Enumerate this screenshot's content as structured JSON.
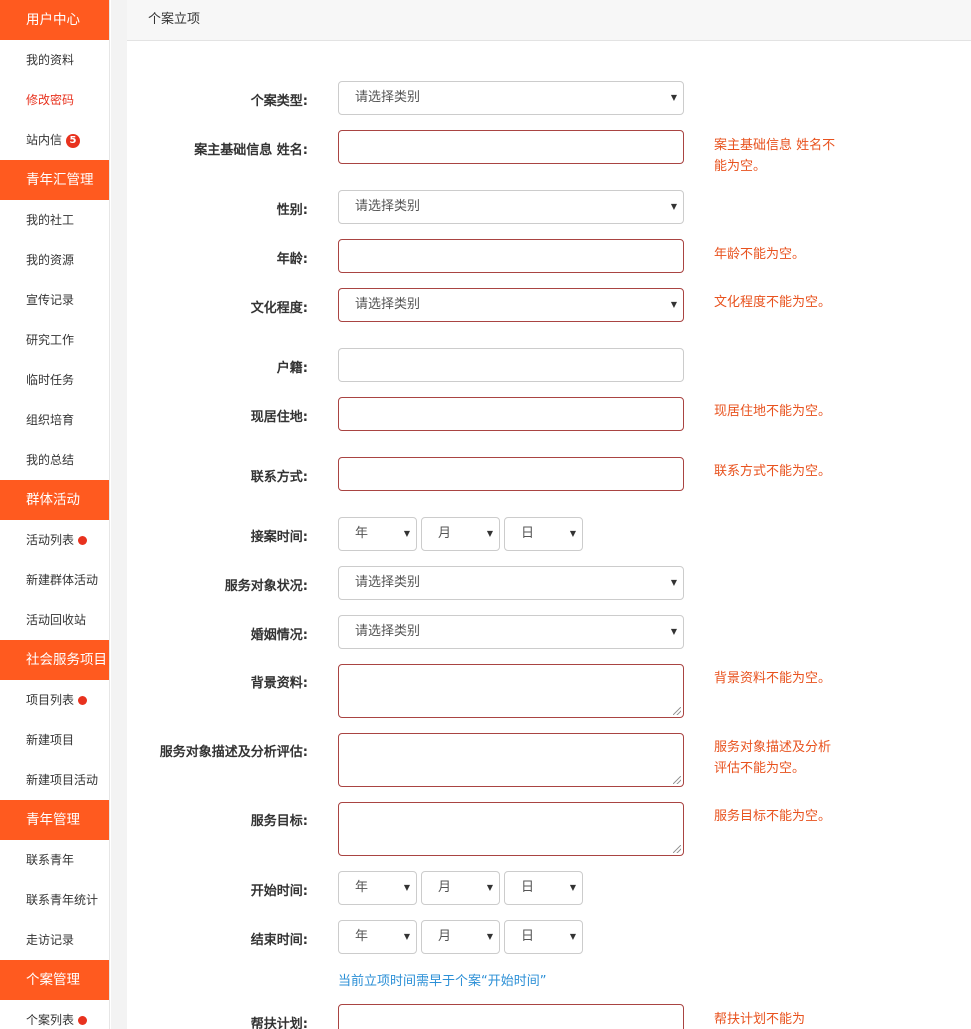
{
  "sidebar": {
    "sections": [
      {
        "title": "用户中心",
        "items": [
          {
            "label": "我的资料"
          },
          {
            "label": "修改密码",
            "active": true
          },
          {
            "label": "站内信",
            "badge": "5"
          }
        ]
      },
      {
        "title": "青年汇管理",
        "items": [
          {
            "label": "我的社工"
          },
          {
            "label": "我的资源"
          },
          {
            "label": "宣传记录"
          },
          {
            "label": "研究工作"
          },
          {
            "label": "临时任务"
          },
          {
            "label": "组织培育"
          },
          {
            "label": "我的总结"
          }
        ]
      },
      {
        "title": "群体活动",
        "items": [
          {
            "label": "活动列表",
            "dot": true
          },
          {
            "label": "新建群体活动"
          },
          {
            "label": "活动回收站"
          }
        ]
      },
      {
        "title": "社会服务项目",
        "items": [
          {
            "label": "项目列表",
            "dot": true
          },
          {
            "label": "新建项目"
          },
          {
            "label": "新建项目活动"
          }
        ]
      },
      {
        "title": "青年管理",
        "items": [
          {
            "label": "联系青年"
          },
          {
            "label": "联系青年统计"
          },
          {
            "label": "走访记录"
          }
        ]
      },
      {
        "title": "个案管理",
        "items": [
          {
            "label": "个案列表",
            "dot": true
          }
        ]
      }
    ]
  },
  "main": {
    "header_title": "个案立项",
    "form": {
      "case_type": {
        "label": "个案类型:",
        "value": "请选择类别"
      },
      "name": {
        "label": "案主基础信息 姓名:",
        "value": "",
        "error": "案主基础信息 姓名不能为空。"
      },
      "gender": {
        "label": "性别:",
        "value": "请选择类别"
      },
      "age": {
        "label": "年龄:",
        "value": "",
        "error": "年龄不能为空。"
      },
      "education": {
        "label": "文化程度:",
        "value": "请选择类别",
        "error": "文化程度不能为空。"
      },
      "hukou": {
        "label": "户籍:",
        "value": ""
      },
      "residence": {
        "label": "现居住地:",
        "value": "",
        "error": "现居住地不能为空。"
      },
      "contact": {
        "label": "联系方式:",
        "value": "",
        "error": "联系方式不能为空。"
      },
      "intake_date": {
        "label": "接案时间:",
        "year": "年",
        "month": "月",
        "day": "日"
      },
      "client_status": {
        "label": "服务对象状况:",
        "value": "请选择类别"
      },
      "marital": {
        "label": "婚姻情况:",
        "value": "请选择类别"
      },
      "background": {
        "label": "背景资料:",
        "value": "",
        "error": "背景资料不能为空。"
      },
      "assessment": {
        "label": "服务对象描述及分析评估:",
        "value": "",
        "error": "服务对象描述及分析评估不能为空。"
      },
      "goals": {
        "label": "服务目标:",
        "value": "",
        "error": "服务目标不能为空。"
      },
      "start_date": {
        "label": "开始时间:",
        "year": "年",
        "month": "月",
        "day": "日"
      },
      "end_date": {
        "label": "结束时间:",
        "year": "年",
        "month": "月",
        "day": "日"
      },
      "date_hint": "当前立项时间需早于个案“开始时间”",
      "plan": {
        "label": "帮扶计划:",
        "value": "",
        "error": "帮扶计划不能为"
      }
    }
  },
  "icons": {
    "caret": "caret-down-icon",
    "resize": "resize-grip-icon"
  },
  "colors": {
    "accent": "#ff5a1f",
    "error_text": "#e8521e",
    "error_border": "#a94442",
    "hint": "#2b8fd6",
    "badge": "#e8321e"
  }
}
